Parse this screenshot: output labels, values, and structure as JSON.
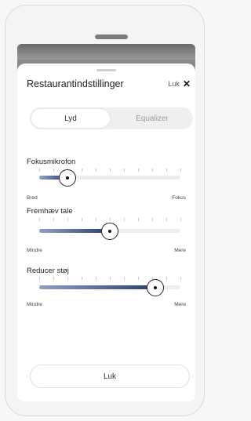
{
  "sheet": {
    "title": "Restaurantindstillinger",
    "close_label": "Luk",
    "close_icon": "close-icon"
  },
  "tabs": [
    {
      "label": "Lyd",
      "active": true
    },
    {
      "label": "Equalizer",
      "active": false
    }
  ],
  "sliders": [
    {
      "label": "Fokusmikrofon",
      "min_label": "Bred",
      "max_label": "Fokus",
      "value": 0.2
    },
    {
      "label": "Fremhæv tale",
      "min_label": "Mindre",
      "max_label": "Mere",
      "value": 0.5
    },
    {
      "label": "Reducer støj",
      "min_label": "Mindre",
      "max_label": "Mere",
      "value": 0.82
    }
  ],
  "footer": {
    "button_label": "Luk"
  }
}
